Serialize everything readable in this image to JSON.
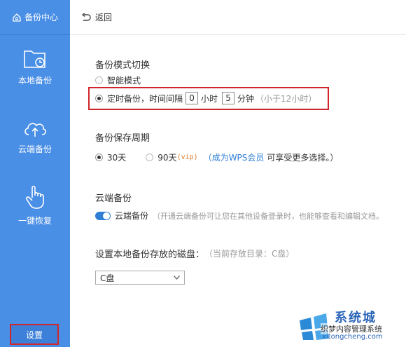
{
  "sidebar": {
    "title": "备份中心",
    "items": [
      {
        "label": "本地备份",
        "icon": "folder-clock-icon"
      },
      {
        "label": "云端备份",
        "icon": "cloud-upload-icon"
      },
      {
        "label": "一键恢复",
        "icon": "hand-pointer-icon"
      }
    ],
    "settings_label": "设置"
  },
  "topbar": {
    "back_label": "返回"
  },
  "backup_mode": {
    "title": "备份模式切换",
    "smart_label": "智能模式",
    "timed_label": "定时备份，时间间隔",
    "hours_value": "0",
    "hours_unit": "小时",
    "minutes_value": "5",
    "minutes_unit": "分钟",
    "note": "（小于12小时）"
  },
  "retention": {
    "title": "备份保存周期",
    "option_30": "30天",
    "option_90": "90天",
    "vip_tag": "(vip)",
    "paren_open": "（",
    "member_link": "成为WPS会员",
    "member_suffix": "可享受更多选择。）"
  },
  "cloud": {
    "title": "云端备份",
    "toggle_label": "云端备份",
    "description": "（开通云端备份可让您在其他设备登录时，也能够查看和编辑文档。"
  },
  "disk": {
    "title": "设置本地备份存放的磁盘：",
    "current_dir": "（当前存放目录：C盘）",
    "selected": "C盘"
  },
  "watermark": {
    "name": "系统城",
    "subtitle": "织梦内容管理系统",
    "url": "xitongcheng.com"
  },
  "colors": {
    "sidebar": "#4a8fe6",
    "highlight": "#d0262b",
    "link": "#2f7fd6"
  }
}
